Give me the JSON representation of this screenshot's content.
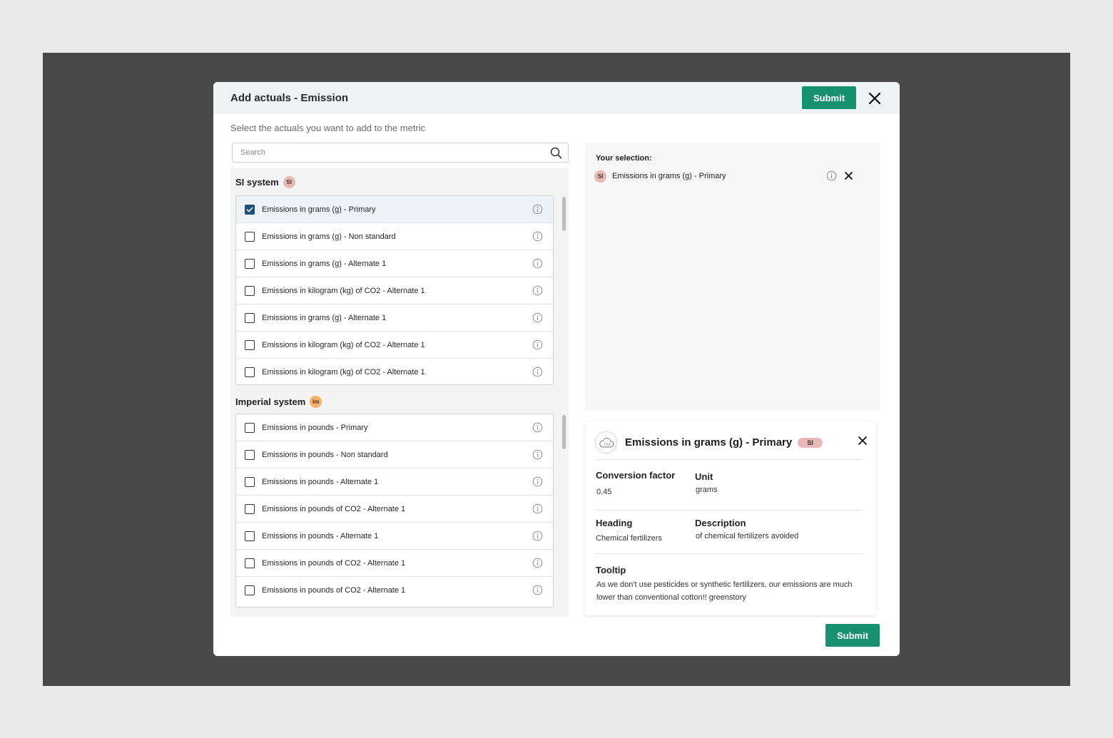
{
  "header": {
    "title": "Add actuals - Emission",
    "submit_label": "Submit"
  },
  "subtitle": "Select the actuals you want to add to the metric",
  "search": {
    "placeholder": "Search"
  },
  "si_group": {
    "title": "SI system",
    "badge": "SI",
    "items": [
      {
        "label": "Emissions in grams (g) - Primary",
        "checked": true
      },
      {
        "label": "Emissions in grams (g) - Non standard",
        "checked": false
      },
      {
        "label": "Emissions in grams (g) - Alternate 1",
        "checked": false
      },
      {
        "label": "Emissions in kilogram (kg) of CO2 - Alternate 1",
        "checked": false
      },
      {
        "label": "Emissions in grams (g) - Alternate 1",
        "checked": false
      },
      {
        "label": "Emissions in kilogram (kg) of CO2 - Alternate 1",
        "checked": false
      },
      {
        "label": "Emissions in kilogram (kg) of CO2 - Alternate 1",
        "checked": false
      }
    ]
  },
  "imperial_group": {
    "title": "Imperial system",
    "badge": "Im",
    "items": [
      {
        "label": "Emissions in pounds - Primary",
        "checked": false
      },
      {
        "label": "Emissions in pounds - Non standard",
        "checked": false
      },
      {
        "label": "Emissions in pounds - Alternate 1",
        "checked": false
      },
      {
        "label": "Emissions in pounds of CO2 - Alternate 1",
        "checked": false
      },
      {
        "label": "Emissions in pounds - Alternate 1",
        "checked": false
      },
      {
        "label": "Emissions in pounds of CO2 - Alternate 1",
        "checked": false
      },
      {
        "label": "Emissions in pounds of CO2 - Alternate 1",
        "checked": false
      }
    ]
  },
  "selection": {
    "title": "Your selection:",
    "badge": "SI",
    "item_label": "Emissions in grams (g) - Primary"
  },
  "detail": {
    "title": "Emissions in grams (g) - Primary",
    "badge": "SI",
    "conversion_label": "Conversion factor",
    "conversion_value": "0.45",
    "unit_label": "Unit",
    "unit_value": "grams",
    "heading_label": "Heading",
    "heading_value": "Chemical fertilizers",
    "description_label": "Description",
    "description_value": "of chemical fertilizers avoided",
    "tooltip_label": "Tooltip",
    "tooltip_value": "As we don't use pesticides or synthetic fertilizers, our emissions are much lower than conventional cotton!! greenstory"
  },
  "footer": {
    "submit_label": "Submit"
  },
  "colors": {
    "accent": "#17916f",
    "checkbox_checked": "#1d4f7a",
    "si_badge": "#e9b8b5",
    "imperial_badge": "#f7b267"
  }
}
